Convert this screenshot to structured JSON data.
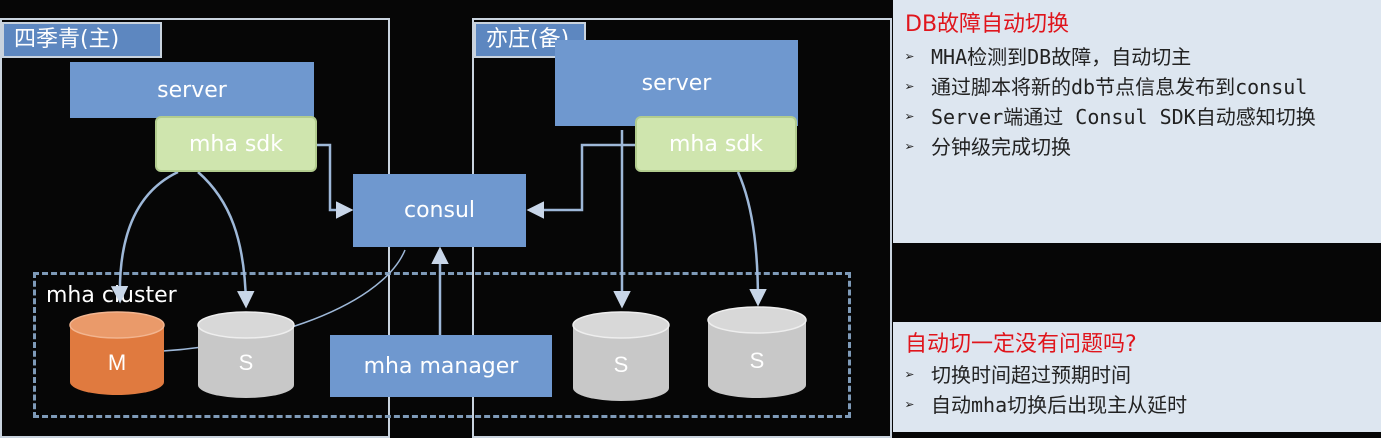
{
  "diagram": {
    "regions": {
      "primary_label": "四季青(主)",
      "backup_label": "亦庄(备)"
    },
    "nodes": {
      "server_left": "server",
      "server_right": "server",
      "mha_sdk_left": "mha sdk",
      "mha_sdk_right": "mha sdk",
      "consul": "consul",
      "mha_manager": "mha manager",
      "cluster_label": "mha cluster",
      "db_master": "M",
      "db_slave_1": "S",
      "db_slave_2": "S",
      "db_slave_3": "S"
    },
    "colors": {
      "background": "#060606",
      "box_blue": "#6f98cf",
      "box_green": "#cfe5ae",
      "master_orange": "#e07a3f",
      "slave_gray": "#c8c8c8"
    }
  },
  "panel_top": {
    "title": "DB故障自动切换",
    "bullets": [
      "MHA检测到DB故障，自动切主",
      "通过脚本将新的db节点信息发布到consul",
      "Server端通过 Consul SDK自动感知切换",
      "分钟级完成切换"
    ]
  },
  "panel_bottom": {
    "title": "自动切一定没有问题吗?",
    "bullets": [
      "切换时间超过预期时间",
      "自动mha切换后出现主从延时"
    ]
  }
}
